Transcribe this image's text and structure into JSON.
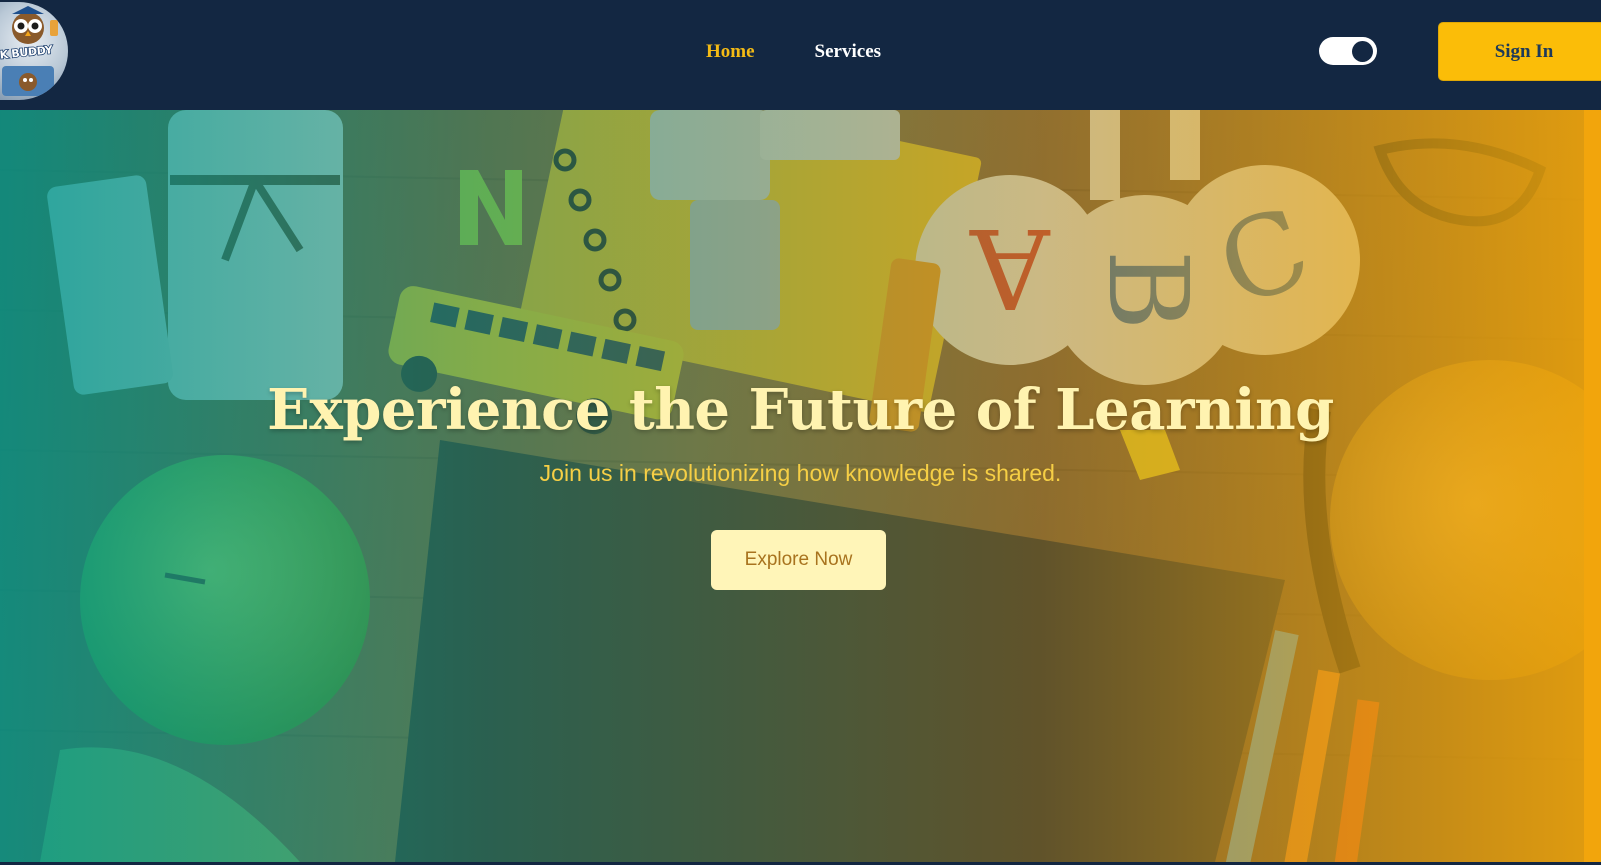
{
  "navbar": {
    "logo_text": "SK BUDDY",
    "links": [
      {
        "label": "Home",
        "active": true
      },
      {
        "label": "Services",
        "active": false
      }
    ],
    "theme_toggle": {
      "state": "on"
    },
    "sign_in_label": "Sign In"
  },
  "hero": {
    "title": "Experience the Future of Learning",
    "subtitle": "Join us in revolutionizing how knowledge is shared.",
    "cta_label": "Explore Now"
  },
  "colors": {
    "navbar_bg": "#132742",
    "accent_yellow": "#fbbd08",
    "active_link": "#f4bb15",
    "hero_title": "#fff3b0",
    "hero_subtitle": "#f6cf45",
    "cta_bg": "#fff5b8",
    "cta_text": "#a8731e",
    "overlay_left": "#009688",
    "overlay_right": "#f5aa0a"
  },
  "icons": {
    "logo": "owl-mascot-logo",
    "toggle": "theme-toggle-switch"
  }
}
